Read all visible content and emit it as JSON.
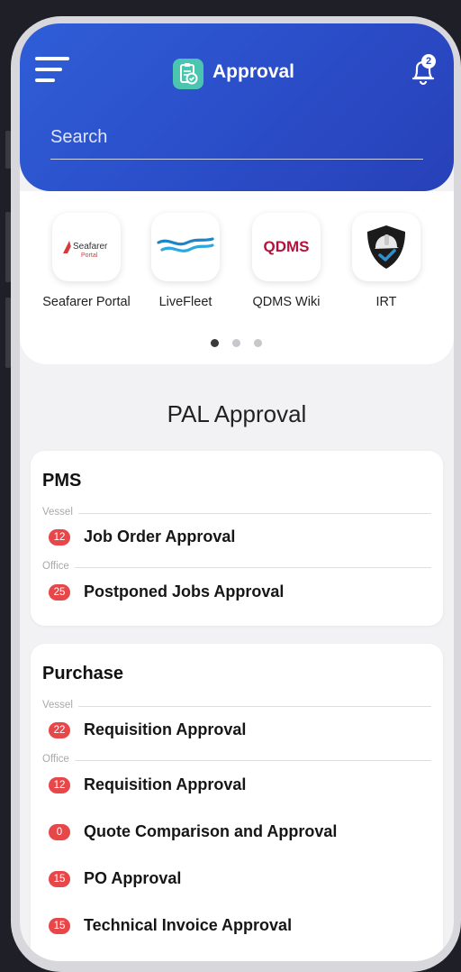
{
  "header": {
    "title": "Approval",
    "notification_count": "2",
    "search_placeholder": "Search",
    "color": "#2a4bc6"
  },
  "shortcuts": {
    "items": [
      {
        "label": "Seafarer Portal",
        "icon": "seafarer-portal-logo",
        "logo_text": "Seafarer",
        "logo_subtext": "Portal"
      },
      {
        "label": "LiveFleet",
        "icon": "livefleet-wave-logo"
      },
      {
        "label": "QDMS Wiki",
        "icon": "qdms-logo",
        "logo_text": "QDMS"
      },
      {
        "label": "IRT",
        "icon": "irt-shield-helmet-logo"
      }
    ],
    "pagination": {
      "pages": 3,
      "active": 1
    }
  },
  "section_title": "PAL Approval",
  "cards": [
    {
      "title": "PMS",
      "groups": [
        {
          "label": "Vessel",
          "items": [
            {
              "count": "12",
              "label": "Job Order Approval"
            }
          ]
        },
        {
          "label": "Office",
          "items": [
            {
              "count": "25",
              "label": "Postponed Jobs Approval"
            }
          ]
        }
      ]
    },
    {
      "title": "Purchase",
      "groups": [
        {
          "label": "Vessel",
          "items": [
            {
              "count": "22",
              "label": "Requisition Approval"
            }
          ]
        },
        {
          "label": "Office",
          "items": [
            {
              "count": "12",
              "label": "Requisition Approval"
            },
            {
              "count": "0",
              "label": "Quote Comparison and Approval"
            },
            {
              "count": "15",
              "label": "PO Approval"
            },
            {
              "count": "15",
              "label": "Technical Invoice Approval"
            }
          ]
        }
      ]
    }
  ],
  "colors": {
    "badge": "#e8474a",
    "app_icon": "#4bc4b0",
    "qdms": "#b4123d"
  }
}
